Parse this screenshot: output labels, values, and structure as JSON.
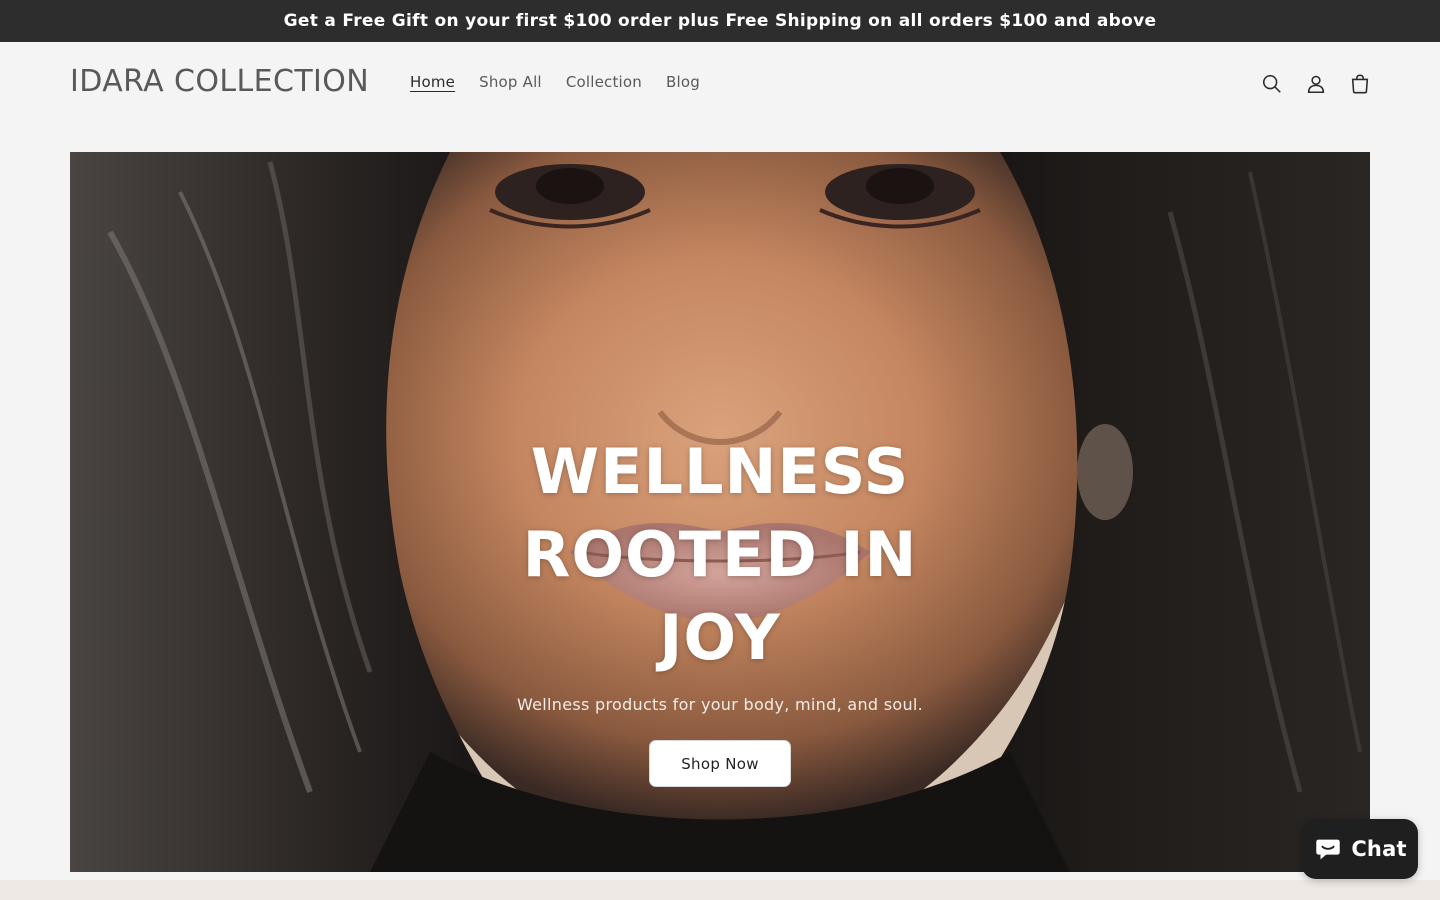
{
  "announcement": {
    "text": "Get a Free Gift on your first $100 order plus Free Shipping on all orders $100 and above"
  },
  "header": {
    "logo": "IDARA COLLECTION",
    "nav": [
      {
        "label": "Home",
        "active": true
      },
      {
        "label": "Shop All",
        "active": false
      },
      {
        "label": "Collection",
        "active": false
      },
      {
        "label": "Blog",
        "active": false
      }
    ],
    "icons": [
      "search-icon",
      "account-icon",
      "cart-icon"
    ]
  },
  "hero": {
    "title_line1": "WELLNESS",
    "title_line2": "ROOTED IN",
    "title_line3": "JOY",
    "subtitle": "Wellness products for your body, mind, and soul.",
    "cta_label": "Shop Now"
  },
  "chat": {
    "label": "Chat",
    "icon": "chat-bubble-icon"
  },
  "colors": {
    "announcement_bg": "#2d2d2d",
    "page_bg": "#f4f4f4",
    "chat_bg": "#1f1f1f"
  }
}
